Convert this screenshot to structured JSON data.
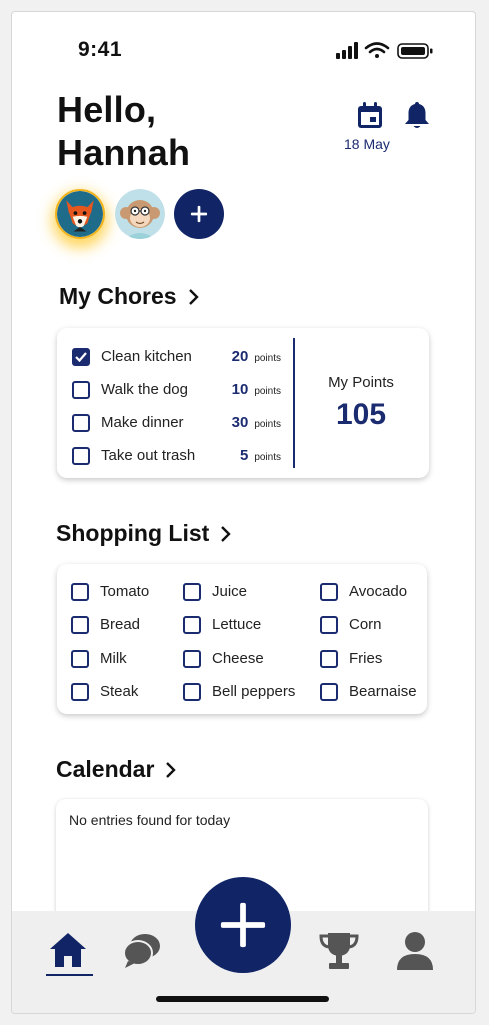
{
  "status_bar": {
    "time": "9:41"
  },
  "header": {
    "greeting": "Hello,\nHannah",
    "date": "18 May"
  },
  "sections": {
    "chores_title": "My Chores",
    "shopping_title": "Shopping List",
    "calendar_title": "Calendar"
  },
  "chores": {
    "items": [
      {
        "label": "Clean kitchen",
        "points": "20",
        "unit": "points",
        "checked": true
      },
      {
        "label": "Walk the dog",
        "points": "10",
        "unit": "points",
        "checked": false
      },
      {
        "label": "Make dinner",
        "points": "30",
        "unit": "points",
        "checked": false
      },
      {
        "label": "Take out trash",
        "points": "5",
        "unit": "points",
        "checked": false
      }
    ],
    "my_points_label": "My Points",
    "my_points_value": "105"
  },
  "shopping": {
    "items": [
      {
        "label": "Tomato"
      },
      {
        "label": "Juice"
      },
      {
        "label": "Avocado"
      },
      {
        "label": "Bread"
      },
      {
        "label": "Lettuce"
      },
      {
        "label": "Corn"
      },
      {
        "label": "Milk"
      },
      {
        "label": "Cheese"
      },
      {
        "label": "Fries"
      },
      {
        "label": "Steak"
      },
      {
        "label": "Bell peppers"
      },
      {
        "label": "Bearnaise"
      }
    ]
  },
  "calendar": {
    "empty_text": "No entries found for today"
  },
  "icons": {
    "calendar": "calendar-icon",
    "bell": "bell-icon",
    "home": "home-icon",
    "chat": "chat-icon",
    "add": "plus-icon",
    "trophy": "trophy-icon",
    "profile": "profile-icon"
  },
  "colors": {
    "primary": "#102466",
    "accent": "#1b2b70",
    "highlight": "#f2b21a"
  }
}
